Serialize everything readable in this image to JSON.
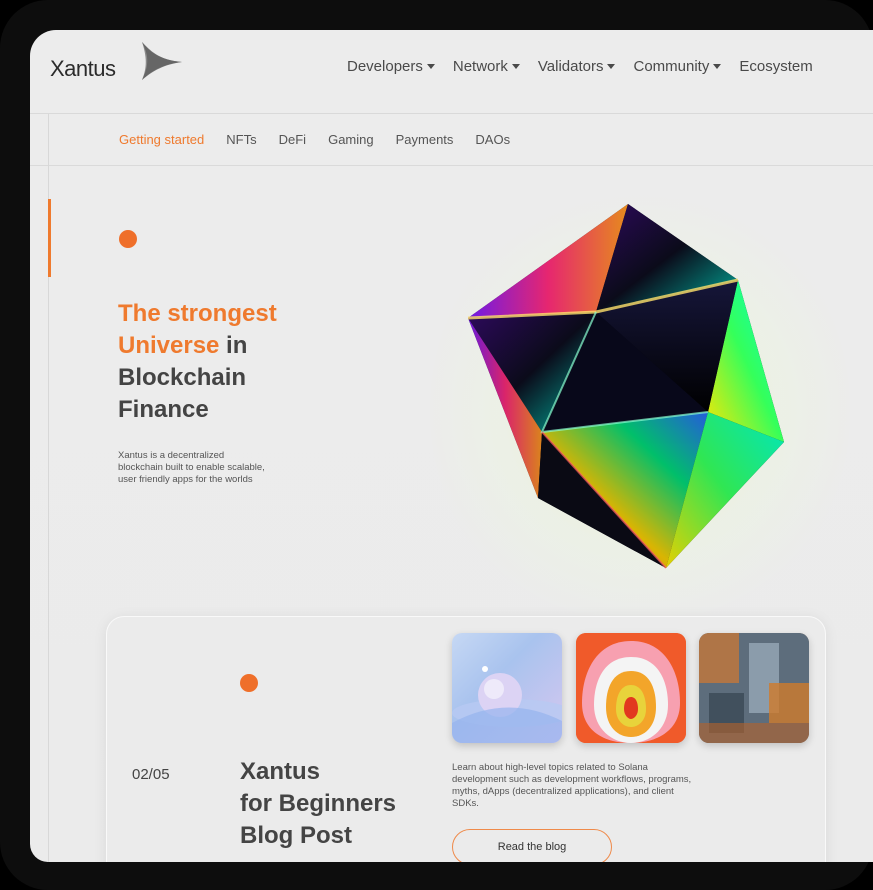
{
  "brand": {
    "name": "Xantus"
  },
  "nav": {
    "items": [
      {
        "label": "Developers",
        "dropdown": true
      },
      {
        "label": "Network",
        "dropdown": true
      },
      {
        "label": "Validators",
        "dropdown": true
      },
      {
        "label": "Community",
        "dropdown": true
      },
      {
        "label": "Ecosystem",
        "dropdown": false
      }
    ]
  },
  "subnav": {
    "items": [
      "Getting started",
      "NFTs",
      "DeFi",
      "Gaming",
      "Payments",
      "DAOs"
    ],
    "active_index": 0
  },
  "hero": {
    "title_highlight": "The strongest Universe",
    "title_rest_inline": " in",
    "title_line3": "Blockchain",
    "title_line4": "Finance",
    "description": "Xantus is  a decentralized blockchain built to enable scalable, user friendly apps for the worlds"
  },
  "blog_card": {
    "pager": "02/05",
    "title_line1": "Xantus",
    "title_line2": "for Beginners",
    "title_line3": "Blog Post",
    "description": "Learn about high-level topics related to Solana development such as development workflows, programs, myths, dApps (decentralized applications), and client SDKs.",
    "button_label": "Read the blog"
  },
  "colors": {
    "accent": "#ef7a2e",
    "text": "#444444",
    "background": "#ececec",
    "device_frame": "#0d0d0d"
  }
}
